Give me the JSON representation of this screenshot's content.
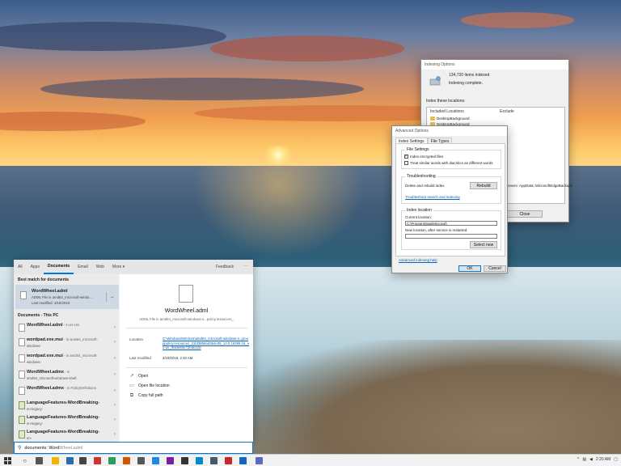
{
  "indexing_options": {
    "title": "Indexing Options",
    "items_indexed": "134,720 items indexed",
    "status": "Indexing complete.",
    "index_label": "Index these locations:",
    "col_included": "Included Locations",
    "col_exclude": "Exclude",
    "locations": [
      "DesktopBackground",
      "DesktopBackground"
    ],
    "exclude_text": "Users: AppData; MicrosoftEdgeBackups",
    "close_label": "Close"
  },
  "advanced_options": {
    "title": "Advanced Options",
    "tab_index": "Index Settings",
    "tab_types": "File Types",
    "file_settings_label": "File Settings",
    "chk_encrypted": "Index encrypted files",
    "chk_diacritics": "Treat similar words with diacritics as different words",
    "troubleshooting_label": "Troubleshooting",
    "rebuild_text": "Delete and rebuild index",
    "rebuild_button": "Rebuild",
    "troubleshoot_link": "Troubleshoot search and indexing",
    "location_label": "Index location",
    "current_location_label": "Current location:",
    "current_location_value": "C:\\ProgramData\\Microsoft",
    "new_location_label": "New location, after service is restarted:",
    "select_new_button": "Select new",
    "advanced_help_link": "Advanced indexing help",
    "ok_label": "OK",
    "cancel_label": "Cancel"
  },
  "search": {
    "nav": [
      "All",
      "Apps",
      "Documents",
      "Email",
      "Web",
      "More ▾"
    ],
    "feedback": "Feedback",
    "more_dots": "···",
    "best_match_header": "Best match for documents",
    "best_match": {
      "name": "WordWheel.adml",
      "sub": "ADML File in amd64_microsoft-windo...",
      "modified": "Last modified: 3/19/2018"
    },
    "documents_header": "Documents - This PC",
    "results": [
      {
        "bold": "WordWheel.adml",
        "dim": " - in es-US",
        "sub": ""
      },
      {
        "bold": "wordpad.exe.mui",
        "dim": " - in wow64_microsoft-",
        "sub": "windows-"
      },
      {
        "bold": "wordpad.exe.mui",
        "dim": " - in amd64_microsoft-",
        "sub": "windows-"
      },
      {
        "bold": "WordWheel.admx",
        "dim": " - in",
        "sub": "amd64_microsoft-windows-shell-"
      },
      {
        "bold": "WordWheel.admx",
        "dim": " - in PolicyDefinitions",
        "sub": ""
      },
      {
        "bold": "LanguageFeatures-WordBreaking-",
        "dim": "",
        "sub": "en-legacy-"
      },
      {
        "bold": "LanguageFeatures-WordBreaking-",
        "dim": "",
        "sub": "en-legacy-"
      },
      {
        "bold": "LanguageFeatures-WordBreaking-",
        "dim": "",
        "sub": "en-"
      }
    ],
    "preview": {
      "title": "WordWheel.adml",
      "subtitle": "ADML File in amd64_microsoft-windows-s...policy.resources_",
      "location_label": "Location",
      "location_value": "C:\\Windows\\WinSxS\\amd64_microsoft-windows-s..grouppolicy.resources_31bf3856ad364e35_10.0.16299.15_es-us_f53de6be72bde12d",
      "modified_label": "Last modified",
      "modified_value": "3/19/2018, 2:20 AM",
      "actions": [
        "Open",
        "Open file location",
        "Copy full path"
      ]
    }
  },
  "searchbox": {
    "typed": "documents: Word",
    "hint": "Wheel.adml"
  },
  "taskbar": {
    "time": "2:20 AM"
  }
}
